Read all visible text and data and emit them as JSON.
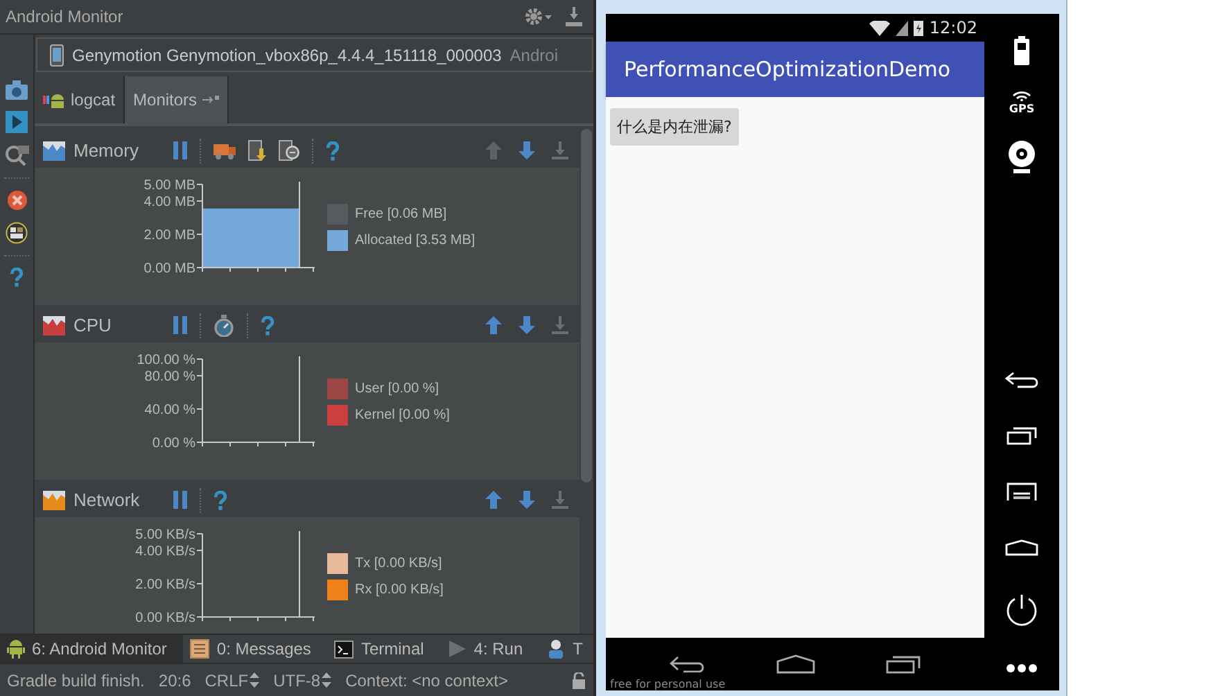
{
  "android_monitor": {
    "title": "Android Monitor",
    "device": {
      "name": "Genymotion Genymotion_vbox86p_4.4.4_151118_000003",
      "detail": "Androi"
    },
    "tabs": [
      {
        "label": "logcat",
        "selected": false
      },
      {
        "label": "Monitors",
        "selected": true
      }
    ],
    "sections": [
      {
        "kind": "memory",
        "title": "Memory",
        "move_up_disabled": true,
        "y_labels": [
          "5.00 MB",
          "4.00 MB",
          "2.00 MB",
          "0.00 MB"
        ],
        "level": 0.71,
        "legend": [
          {
            "label": "Free [0.06 MB]",
            "color": "#585b5e"
          },
          {
            "label": "Allocated [3.53 MB]",
            "color": "#75a9d9"
          }
        ]
      },
      {
        "kind": "cpu",
        "title": "CPU",
        "move_up_disabled": false,
        "y_labels": [
          "100.00 %",
          "80.00 %",
          "40.00 %",
          "0.00 %"
        ],
        "legend": [
          {
            "label": "User [0.00 %]",
            "color": "#9c4646"
          },
          {
            "label": "Kernel [0.00 %]",
            "color": "#cb3f3f"
          }
        ]
      },
      {
        "kind": "network",
        "title": "Network",
        "move_up_disabled": false,
        "y_labels": [
          "5.00 KB/s",
          "4.00 KB/s",
          "2.00 KB/s",
          "0.00 KB/s"
        ],
        "legend": [
          {
            "label": "Tx [0.00 KB/s]",
            "color": "#e5b99a"
          },
          {
            "label": "Rx [0.00 KB/s]",
            "color": "#ef8218"
          }
        ]
      }
    ],
    "tool_windows": [
      {
        "kind": "android",
        "label": "6: Android Monitor",
        "selected": true
      },
      {
        "kind": "messages",
        "label": "0: Messages",
        "selected": false
      },
      {
        "kind": "terminal",
        "label": "Terminal",
        "selected": false
      },
      {
        "kind": "run",
        "label": "4: Run",
        "selected": false
      },
      {
        "kind": "todo",
        "label": "T",
        "selected": false
      }
    ],
    "status_bar": {
      "message": "Gradle build finish.",
      "position": "20:6",
      "line_separator": "CRLF",
      "encoding": "UTF-8",
      "context": "Context: <no context>"
    }
  },
  "emulator": {
    "time": "12:02",
    "app_title": "PerformanceOptimizationDemo",
    "button": "什么是内在泄漏?",
    "gps_label": "GPS",
    "note": "free for personal use"
  }
}
